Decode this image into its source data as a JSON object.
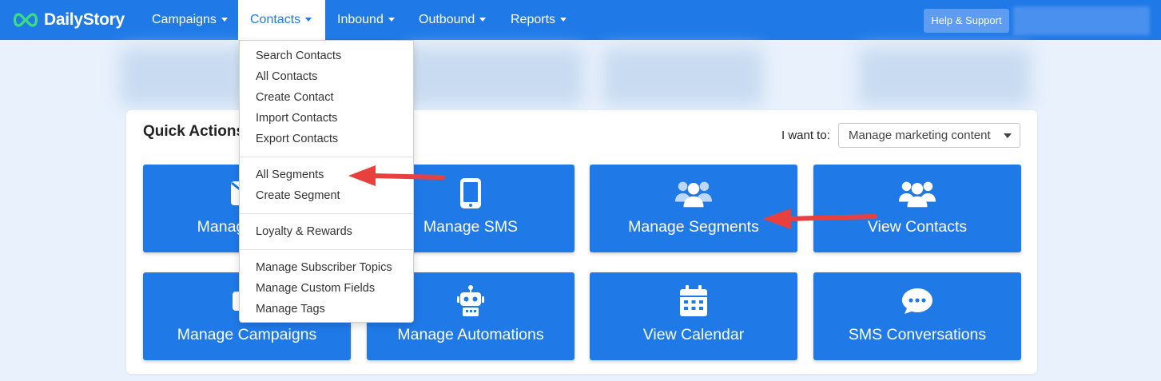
{
  "brand": {
    "name": "DailyStory"
  },
  "nav": {
    "items": [
      {
        "label": "Campaigns",
        "active": false
      },
      {
        "label": "Contacts",
        "active": true
      },
      {
        "label": "Inbound",
        "active": false
      },
      {
        "label": "Outbound",
        "active": false
      },
      {
        "label": "Reports",
        "active": false
      }
    ],
    "help_label": "Help & Support"
  },
  "contacts_menu": {
    "groups": [
      [
        "Search Contacts",
        "All Contacts",
        "Create Contact",
        "Import Contacts",
        "Export Contacts"
      ],
      [
        "All Segments",
        "Create Segment"
      ],
      [
        "Loyalty & Rewards"
      ],
      [
        "Manage Subscriber Topics",
        "Manage Custom Fields",
        "Manage Tags"
      ]
    ]
  },
  "quick_actions": {
    "title": "Quick Actions",
    "want_label": "I want to:",
    "want_value": "Manage marketing content",
    "tiles": [
      {
        "label": "Manage Email",
        "icon": "envelope-icon"
      },
      {
        "label": "Manage SMS",
        "icon": "mobile-phone-icon"
      },
      {
        "label": "Manage Segments",
        "icon": "users-group-icon"
      },
      {
        "label": "View Contacts",
        "icon": "users-group-icon"
      },
      {
        "label": "Manage Campaigns",
        "icon": "campaign-icon"
      },
      {
        "label": "Manage Automations",
        "icon": "robot-icon"
      },
      {
        "label": "View Calendar",
        "icon": "calendar-icon"
      },
      {
        "label": "SMS Conversations",
        "icon": "chat-bubble-icon"
      }
    ]
  },
  "colors": {
    "primary": "#1f7ae8",
    "background": "#e8f1fc",
    "annotation_arrow": "#e8413d"
  }
}
